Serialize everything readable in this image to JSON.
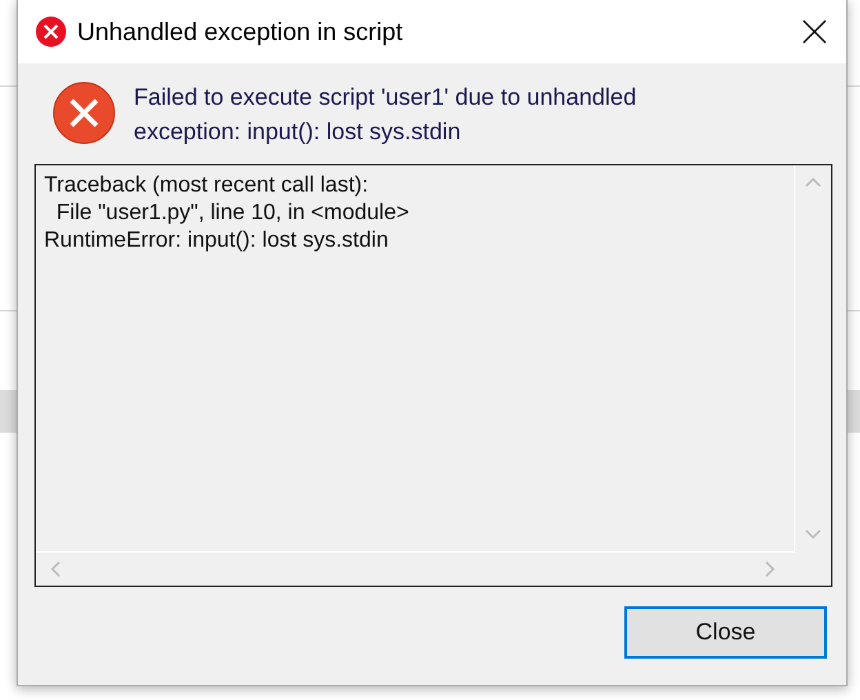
{
  "window": {
    "title": "Unhandled exception in script"
  },
  "message": "Failed to execute script 'user1' due to unhandled exception: input(): lost sys.stdin",
  "details": [
    "Traceback (most recent call last):",
    "  File \"user1.py\", line 10, in <module>",
    "RuntimeError: input(): lost sys.stdin"
  ],
  "buttons": [
    {
      "label": "Close",
      "selected": true
    }
  ]
}
